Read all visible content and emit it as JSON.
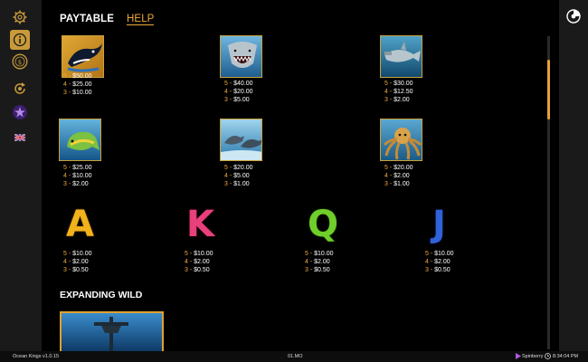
{
  "tabs": {
    "paytable": "PAYTABLE",
    "help": "HELP"
  },
  "symbols_row1": [
    {
      "name": "orca",
      "pays": [
        {
          "n": "5",
          "v": "$50.00"
        },
        {
          "n": "4",
          "v": "$25.00"
        },
        {
          "n": "3",
          "v": "$10.00"
        }
      ]
    },
    {
      "name": "shark",
      "pays": [
        {
          "n": "5",
          "v": "$40.00"
        },
        {
          "n": "4",
          "v": "$20.00"
        },
        {
          "n": "3",
          "v": "$5.00"
        }
      ]
    },
    {
      "name": "hammerhead",
      "pays": [
        {
          "n": "5",
          "v": "$30.00"
        },
        {
          "n": "4",
          "v": "$12.50"
        },
        {
          "n": "3",
          "v": "$2.00"
        }
      ]
    }
  ],
  "symbols_row2": [
    {
      "name": "mahi-mahi",
      "pays": [
        {
          "n": "5",
          "v": "$25.00"
        },
        {
          "n": "4",
          "v": "$10.00"
        },
        {
          "n": "3",
          "v": "$2.00"
        }
      ]
    },
    {
      "name": "dolphins",
      "pays": [
        {
          "n": "5",
          "v": "$20.00"
        },
        {
          "n": "4",
          "v": "$5.00"
        },
        {
          "n": "3",
          "v": "$1.00"
        }
      ]
    },
    {
      "name": "octopus",
      "pays": [
        {
          "n": "5",
          "v": "$20.00"
        },
        {
          "n": "4",
          "v": "$2.00"
        },
        {
          "n": "3",
          "v": "$1.00"
        }
      ]
    }
  ],
  "letters": [
    {
      "char": "A",
      "pays": [
        {
          "n": "5",
          "v": "$10.00"
        },
        {
          "n": "4",
          "v": "$2.00"
        },
        {
          "n": "3",
          "v": "$0.50"
        }
      ]
    },
    {
      "char": "K",
      "pays": [
        {
          "n": "5",
          "v": "$10.00"
        },
        {
          "n": "4",
          "v": "$2.00"
        },
        {
          "n": "3",
          "v": "$0.50"
        }
      ]
    },
    {
      "char": "Q",
      "pays": [
        {
          "n": "5",
          "v": "$10.00"
        },
        {
          "n": "4",
          "v": "$2.00"
        },
        {
          "n": "3",
          "v": "$0.50"
        }
      ]
    },
    {
      "char": "J",
      "pays": [
        {
          "n": "5",
          "v": "$10.00"
        },
        {
          "n": "4",
          "v": "$2.00"
        },
        {
          "n": "3",
          "v": "$0.50"
        }
      ]
    }
  ],
  "section": {
    "expanding_wild": "EXPANDING WILD"
  },
  "footer": {
    "game": "Ocean Kings v1.0.15",
    "mode": "01.MO",
    "brand": "Spinberry",
    "time": "8:34:04 PM"
  },
  "sidebar_icons": [
    "settings-icon",
    "info-icon",
    "bet-icon",
    "autoplay-icon",
    "bonus-icon",
    "language-flag-icon"
  ],
  "colors": {
    "accent": "#f0a93a",
    "sidebar": "#1a1a1a",
    "background": "#000000"
  }
}
